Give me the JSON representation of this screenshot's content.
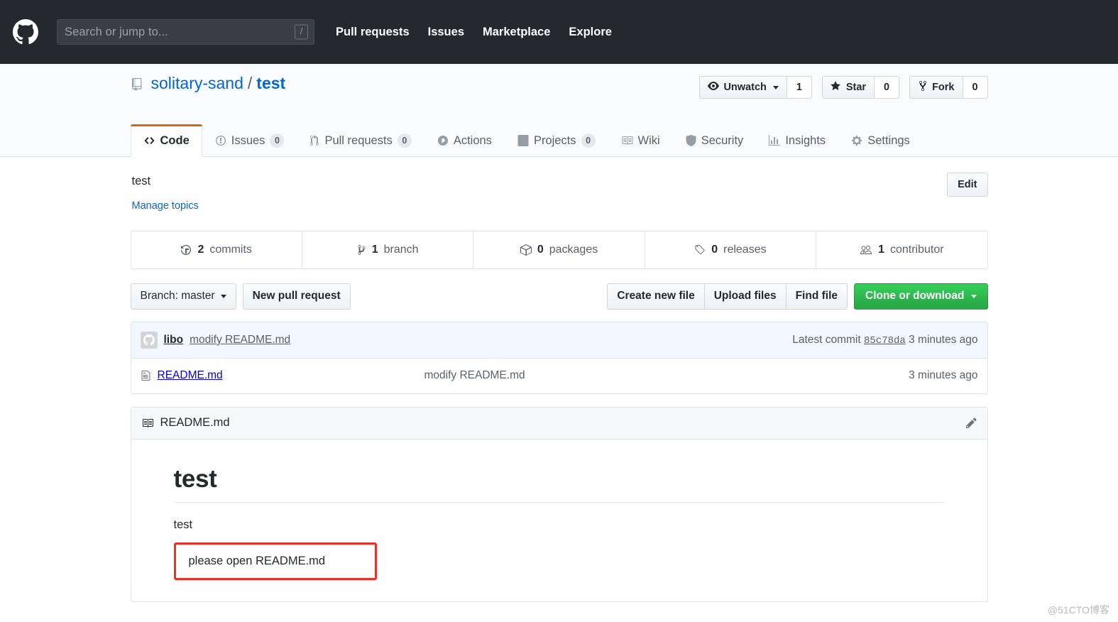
{
  "header": {
    "logo_icon": "github-mark-icon",
    "search": {
      "placeholder": "Search or jump to...",
      "shortcut_key": "/"
    },
    "nav": [
      {
        "label": "Pull requests"
      },
      {
        "label": "Issues"
      },
      {
        "label": "Marketplace"
      },
      {
        "label": "Explore"
      }
    ]
  },
  "repo": {
    "icon": "repo-icon",
    "owner": "solitary-sand",
    "separator": "/",
    "name": "test",
    "actions": [
      {
        "icon": "eye-icon",
        "label": "Unwatch",
        "has_caret": true,
        "count": "1"
      },
      {
        "icon": "star-icon",
        "label": "Star",
        "has_caret": false,
        "count": "0"
      },
      {
        "icon": "fork-icon",
        "label": "Fork",
        "has_caret": false,
        "count": "0"
      }
    ]
  },
  "tabs": [
    {
      "id": "code",
      "icon": "code-icon",
      "label": "Code",
      "count": null,
      "selected": true
    },
    {
      "id": "issues",
      "icon": "issue-opened-icon",
      "label": "Issues",
      "count": "0",
      "selected": false
    },
    {
      "id": "pull-requests",
      "icon": "git-pull-request-icon",
      "label": "Pull requests",
      "count": "0",
      "selected": false
    },
    {
      "id": "actions",
      "icon": "play-icon",
      "label": "Actions",
      "count": null,
      "selected": false
    },
    {
      "id": "projects",
      "icon": "project-icon",
      "label": "Projects",
      "count": "0",
      "selected": false
    },
    {
      "id": "wiki",
      "icon": "book-icon",
      "label": "Wiki",
      "count": null,
      "selected": false
    },
    {
      "id": "security",
      "icon": "shield-icon",
      "label": "Security",
      "count": null,
      "selected": false
    },
    {
      "id": "insights",
      "icon": "graph-icon",
      "label": "Insights",
      "count": null,
      "selected": false
    },
    {
      "id": "settings",
      "icon": "gear-icon",
      "label": "Settings",
      "count": null,
      "selected": false
    }
  ],
  "description": {
    "text": "test",
    "manage_topics_label": "Manage topics",
    "edit_label": "Edit"
  },
  "overview": [
    {
      "icon": "history-icon",
      "num": "2",
      "label": "commits"
    },
    {
      "icon": "branch-icon",
      "num": "1",
      "label": "branch"
    },
    {
      "icon": "package-icon",
      "num": "0",
      "label": "packages"
    },
    {
      "icon": "tag-icon",
      "num": "0",
      "label": "releases"
    },
    {
      "icon": "people-icon",
      "num": "1",
      "label": "contributor"
    }
  ],
  "toolbar": {
    "branch_label": "Branch: master",
    "new_pull_request_label": "New pull request",
    "create_new_file_label": "Create new file",
    "upload_files_label": "Upload files",
    "find_file_label": "Find file",
    "clone_label": "Clone or download"
  },
  "commit_tease": {
    "avatar_icon": "github-mark-icon",
    "author": "libo",
    "message": "modify README.md",
    "latest_prefix": "Latest commit",
    "sha": "85c78da",
    "age": "3 minutes ago"
  },
  "files": [
    {
      "icon": "file-icon",
      "name": "README.md",
      "message": "modify README.md",
      "age": "3 minutes ago"
    }
  ],
  "readme": {
    "icon": "book-icon",
    "title": "README.md",
    "edit_icon": "pencil-icon",
    "heading": "test",
    "paragraph_1": "test",
    "highlighted_paragraph": "please open README.md",
    "highlight_color": "#f42d22"
  },
  "watermark": {
    "text": "@51CTO博客"
  },
  "colors": {
    "header_bg": "#24292e",
    "link": "#0366d6",
    "muted": "#586069",
    "border": "#e1e4e8",
    "tab_active_underline": "#d26911",
    "green_button": "#28a745",
    "commit_tease_bg": "#f1f8ff"
  }
}
